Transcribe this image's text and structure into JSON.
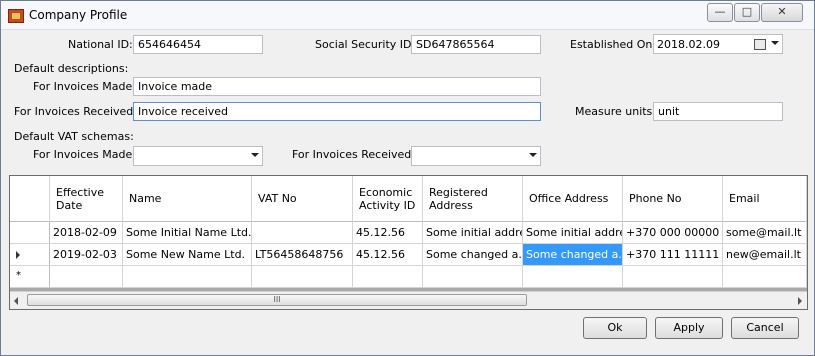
{
  "window": {
    "title": "Company Profile"
  },
  "fields": {
    "national_id_label": "National ID:",
    "national_id_value": "654646454",
    "ssn_label": "Social Security ID:",
    "ssn_value": "SD647865564",
    "established_label": "Established On:",
    "established_value": "2018.02.09",
    "default_descriptions_label": "Default descriptions:",
    "invoices_made_label": "For Invoices Made:",
    "invoices_made_value": "Invoice made",
    "invoices_received_label": "For Invoices Received:",
    "invoices_received_value": "Invoice received",
    "measure_units_label": "Measure units:",
    "measure_units_value": "unit",
    "default_vat_label": "Default VAT schemas:",
    "vat_made_label": "For Invoices Made:",
    "vat_made_value": "",
    "vat_received_label": "For Invoices Received:",
    "vat_received_value": ""
  },
  "grid": {
    "headers": [
      "Effective Date",
      "Name",
      "VAT No",
      "Economic Activity ID",
      "Registered Address",
      "Office Address",
      "Phone No",
      "Email"
    ],
    "rows": [
      [
        "2018-02-09",
        "Some Initial Name Ltd.",
        "",
        "45.12.56",
        "Some initial addre...",
        "Some initial addre...",
        "+370 000 00000",
        "some@mail.lt"
      ],
      [
        "2019-02-03",
        "Some New Name Ltd.",
        "LT56458648756",
        "45.12.56",
        "Some changed a...",
        "Some changed a...",
        "+370 111 11111",
        "new@email.lt"
      ]
    ],
    "scroll_thumb_glyph": "III"
  },
  "buttons": {
    "ok": "Ok",
    "apply": "Apply",
    "cancel": "Cancel"
  },
  "icons": {
    "app": "app-icon",
    "minimize": "minimize-icon",
    "maximize": "maximize-icon",
    "close": "close-icon",
    "calendar": "calendar-icon"
  },
  "colors": {
    "selection": "#3399ff",
    "grid_background": "#a9a9a9"
  }
}
